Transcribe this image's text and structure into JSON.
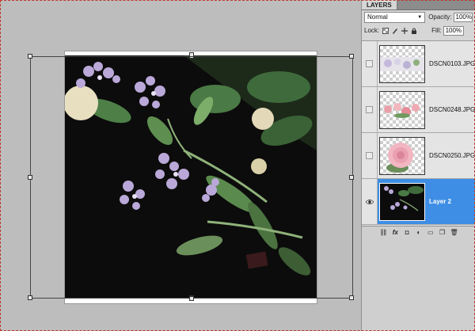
{
  "layers_panel": {
    "tab_label": "LAYERS",
    "blend_mode": "Normal",
    "opacity_label": "Opacity:",
    "opacity_value": "100%",
    "lock_label": "Lock:",
    "fill_label": "Fill:",
    "fill_value": "100%",
    "layers": [
      {
        "name": "DSCN0103.JPG",
        "visible": false,
        "selected": false
      },
      {
        "name": "DSCN0248.JPG",
        "visible": false,
        "selected": false
      },
      {
        "name": "DSCN0250.JPG",
        "visible": false,
        "selected": false
      },
      {
        "name": "Layer 2",
        "visible": true,
        "selected": true
      }
    ],
    "footer_icons": [
      "link-icon",
      "fx-icon",
      "mask-icon",
      "adjustment-icon",
      "group-folder-icon",
      "new-layer-icon",
      "trash-icon"
    ]
  },
  "colors": {
    "workspace": "#bdbdbd",
    "selection": "#3d8ee4",
    "marquee": "#c0392b"
  }
}
